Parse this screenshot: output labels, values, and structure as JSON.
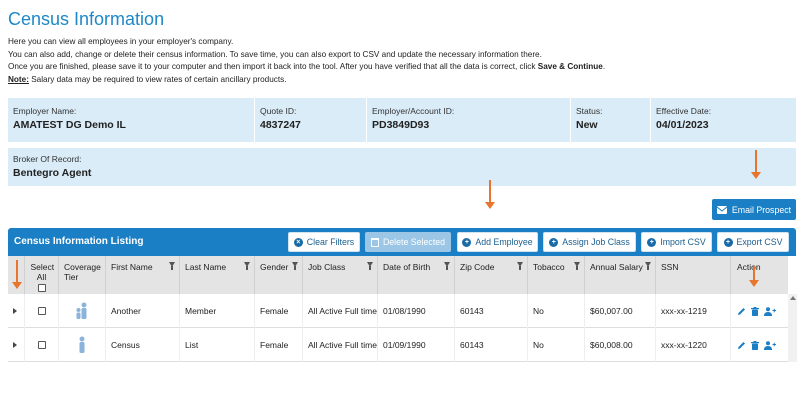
{
  "page": {
    "title": "Census Information",
    "intro_lines": [
      "Here you can view all employees in your employer's company.",
      "You can also add, change or delete their census information. To save time, you can also export to CSV and update the necessary information there.",
      "Once you are finished, please save it to your computer and then import it back into the tool. After you have verified that all the data is correct, click "
    ],
    "intro_bold": "Save & Continue",
    "intro_note_label": "Note:",
    "intro_note": " Salary data may be required to view rates of certain ancillary products."
  },
  "employer": {
    "name_label": "Employer Name:",
    "name": "AMATEST DG Demo IL",
    "quote_label": "Quote ID:",
    "quote": "4837247",
    "account_label": "Employer/Account ID:",
    "account": "PD3849D93",
    "status_label": "Status:",
    "status": "New",
    "date_label": "Effective Date:",
    "date": "04/01/2023"
  },
  "broker": {
    "label": "Broker Of Record:",
    "value": "Bentegro Agent"
  },
  "email_button": "Email Prospect",
  "listing": {
    "title": "Census Information Listing",
    "buttons": {
      "clear": "Clear Filters",
      "delete": "Delete Selected",
      "add": "Add Employee",
      "assign": "Assign Job Class",
      "import": "Import CSV",
      "export": "Export CSV"
    }
  },
  "columns": {
    "select": "Select All",
    "coverage": "Coverage Tier",
    "first": "First Name",
    "last": "Last Name",
    "gender": "Gender",
    "job": "Job Class",
    "dob": "Date of Birth",
    "zip": "Zip Code",
    "tobacco": "Tobacco",
    "salary": "Annual Salary",
    "ssn": "SSN",
    "action": "Action"
  },
  "rows": [
    {
      "first": "Another",
      "last": "Member",
      "gender": "Female",
      "job": "All Active Full time",
      "dob": "01/08/1990",
      "zip": "60143",
      "tobacco": "No",
      "salary": "$60,007.00",
      "ssn": "xxx-xx-1219"
    },
    {
      "first": "Census",
      "last": "List",
      "gender": "Female",
      "job": "All Active Full time",
      "dob": "01/09/1990",
      "zip": "60143",
      "tobacco": "No",
      "salary": "$60,008.00",
      "ssn": "xxx-xx-1220"
    }
  ],
  "colors": {
    "accent": "#1a7fc4",
    "title": "#1e88c8",
    "info_bg": "#d9ecf8",
    "arrow": "#e8752d"
  },
  "icons": [
    "envelope-icon",
    "close-circle-icon",
    "trash-icon",
    "plus-circle-icon",
    "filter-icon",
    "pencil-icon",
    "add-user-icon",
    "person-icon",
    "expand-icon"
  ]
}
